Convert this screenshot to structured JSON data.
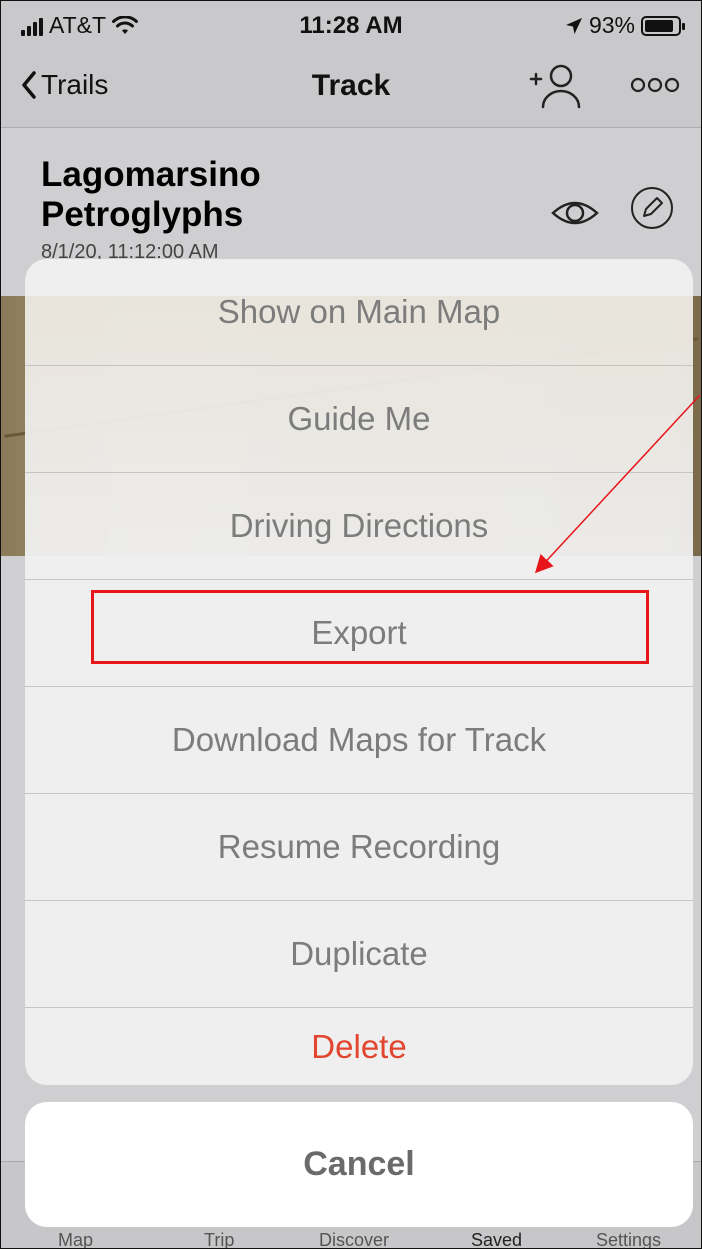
{
  "status_bar": {
    "carrier": "AT&T",
    "time": "11:28 AM",
    "battery": "93%"
  },
  "nav": {
    "back_label": "Trails",
    "title": "Track"
  },
  "track": {
    "title_line1": "Lagomarsino",
    "title_line2": "Petroglyphs",
    "date": "8/1/20, 11:12:00 AM"
  },
  "action_sheet": {
    "items": [
      {
        "label": "Show on Main Map"
      },
      {
        "label": "Guide Me"
      },
      {
        "label": "Driving Directions"
      },
      {
        "label": "Export"
      },
      {
        "label": "Download Maps for Track"
      },
      {
        "label": "Resume Recording"
      },
      {
        "label": "Duplicate"
      },
      {
        "label": "Delete"
      }
    ],
    "cancel_label": "Cancel"
  },
  "tab_bar": {
    "items": [
      "Map",
      "Trip",
      "Discover",
      "Saved",
      "Settings"
    ]
  },
  "colors": {
    "destructive": "#e2462f",
    "annotation": "#e8151a"
  }
}
